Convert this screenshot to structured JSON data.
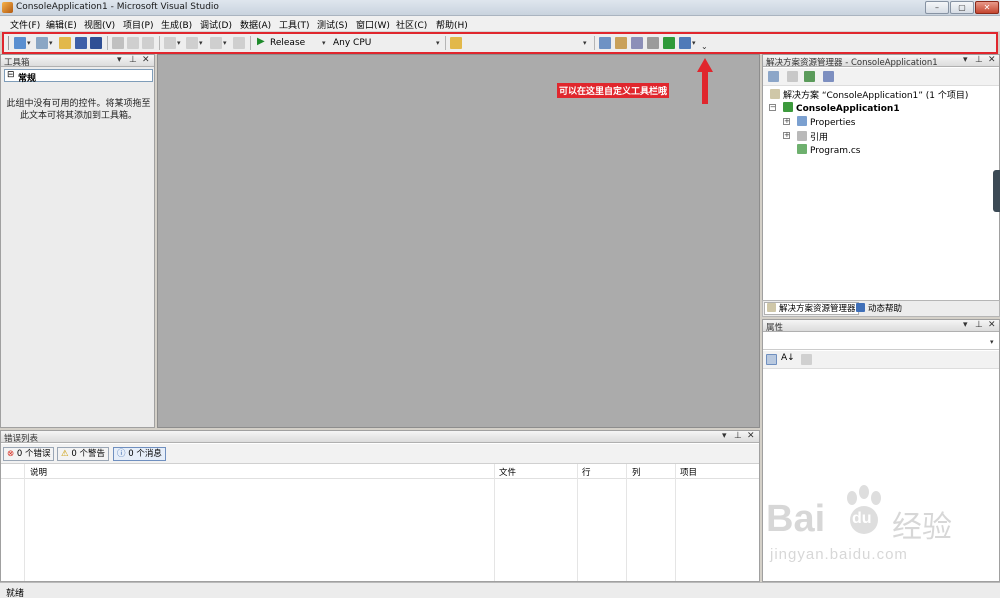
{
  "window": {
    "title": "ConsoleApplication1 - Microsoft Visual Studio",
    "min": "–",
    "max": "▢",
    "close": "✕"
  },
  "menu": [
    "文件(F)",
    "编辑(E)",
    "视图(V)",
    "项目(P)",
    "生成(B)",
    "调试(D)",
    "数据(A)",
    "工具(T)",
    "测试(S)",
    "窗口(W)",
    "社区(C)",
    "帮助(H)"
  ],
  "toolbar": {
    "configuration": "Release",
    "platform": "Any CPU"
  },
  "annotation": "可以在这里自定义工具栏哦",
  "toolbox": {
    "title": "工具箱",
    "group": "常规",
    "empty_text_line1": "此组中没有可用的控件。将某项拖至",
    "empty_text_line2": "此文本可将其添加到工具箱。"
  },
  "solution_explorer": {
    "title": "解决方案资源管理器 - ConsoleApplication1",
    "solution": "解决方案 “ConsoleApplication1” (1 个项目)",
    "project": "ConsoleApplication1",
    "items": [
      "Properties",
      "引用",
      "Program.cs"
    ],
    "tabs": [
      "解决方案资源管理器",
      "动态帮助"
    ]
  },
  "properties": {
    "title": "属性"
  },
  "error_list": {
    "title": "错误列表",
    "errors": "0 个错误",
    "warnings": "0 个警告",
    "messages": "0 个消息",
    "columns": [
      "说明",
      "文件",
      "行",
      "列",
      "项目"
    ]
  },
  "status": "就绪",
  "watermark": {
    "brand": "Bai",
    "brand2": "du",
    "cn": "经验",
    "url": "jingyan.baidu.com"
  },
  "colors": {
    "annotation": "#e0262d",
    "editor_bg": "#ababab"
  }
}
